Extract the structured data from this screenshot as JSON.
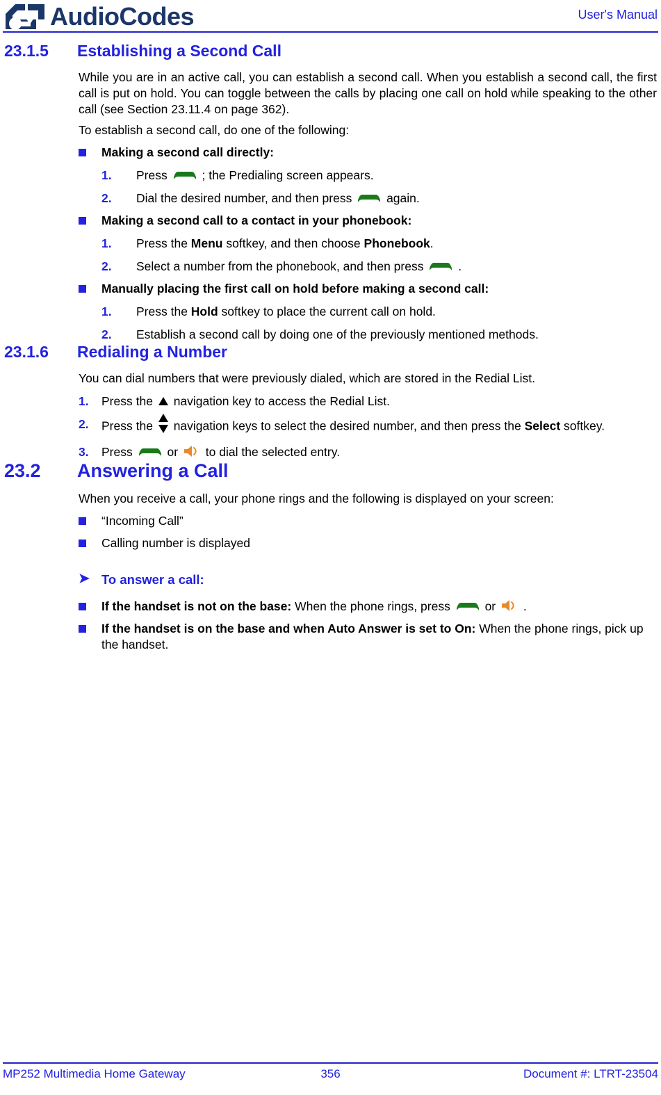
{
  "header": {
    "brand_text_audio": "Audio",
    "brand_text_codes": "Codes",
    "doc_type": "User's Manual",
    "brand_color": "#1b3668",
    "accent_color": "#2222e0"
  },
  "footer": {
    "left": "MP252 Multimedia Home Gateway",
    "page_number": "356",
    "right": "Document #: LTRT-23504"
  },
  "icons": {
    "handset_color": "#1a7a1a",
    "speaker_color": "#e8892a",
    "nav_color": "#000000",
    "handset_name": "green-handset-key-icon",
    "speaker_name": "orange-speaker-key-icon",
    "nav_up_name": "nav-up-key-icon",
    "nav_updown_name": "nav-up-down-key-icon"
  },
  "sections": [
    {
      "number": "23.1.5",
      "title": "Establishing a Second Call",
      "level": 3,
      "paragraph_1": "While you are in an active call, you can establish a second call. When you establish a second call, the first call is put on hold. You can toggle between the calls by placing one call on hold while speaking to the other call (see Section 23.11.4 on page 362).",
      "paragraph_2": "To establish a second call, do one of the following:",
      "bullets": [
        {
          "heading": "Making a second call directly:",
          "steps": [
            {
              "before": "Press",
              "icon": "handset",
              "after": "; the Predialing screen appears."
            },
            {
              "before": "Dial the desired number, and then press",
              "icon": "handset",
              "after": "again."
            }
          ]
        },
        {
          "heading": "Making a second call to a contact in your phonebook:",
          "steps": [
            {
              "before": "Press the ",
              "bold1": "Menu",
              "mid": " softkey, and then choose ",
              "bold2": "Phonebook",
              "after": "."
            },
            {
              "before": "Select a number from the phonebook, and then press",
              "icon": "handset",
              "after": "."
            }
          ]
        },
        {
          "heading": "Manually placing the first call on hold before making a second call:",
          "steps": [
            {
              "before": "Press the ",
              "bold1": "Hold",
              "mid": " softkey to place the current call on hold.",
              "after": ""
            },
            {
              "before": "Establish a second call by doing one of the previously mentioned methods.",
              "after": ""
            }
          ]
        }
      ]
    },
    {
      "number": "23.1.6",
      "title": "Redialing a Number",
      "level": 3,
      "paragraph_1": "You can dial numbers that were previously dialed, which are stored in the Redial List.",
      "steps": [
        {
          "n": "1.",
          "before": "Press the",
          "icon": "navup",
          "after": "navigation key to access the Redial List."
        },
        {
          "n": "2.",
          "before": "Press the",
          "icon": "navupdown",
          "after": "navigation keys to select the desired number, and then press the ",
          "bold1": "Select",
          "tail": " softkey."
        },
        {
          "n": "3.",
          "before": "Press",
          "icon": "handset",
          "mid": "or",
          "icon2": "speaker",
          "after": "to dial the selected entry."
        }
      ]
    },
    {
      "number": "23.2",
      "title": "Answering a Call",
      "level": 2,
      "paragraph_1": "When you receive a call, your phone rings and the following is displayed on your screen:",
      "bullets": [
        {
          "text": "“Incoming Call”"
        },
        {
          "text": "Calling number is displayed"
        }
      ],
      "procedure_heading": "To answer a call:",
      "procedure_bullets": [
        {
          "bold": "If the handset is not on the base:",
          "before": " When the phone rings, press",
          "icon": "handset",
          "mid": "or",
          "icon2": "speaker",
          "after": "."
        },
        {
          "bold": "If the handset is on the base and when Auto Answer is set to On:",
          "before": " When the phone rings, pick up the handset.",
          "after": ""
        }
      ]
    }
  ]
}
